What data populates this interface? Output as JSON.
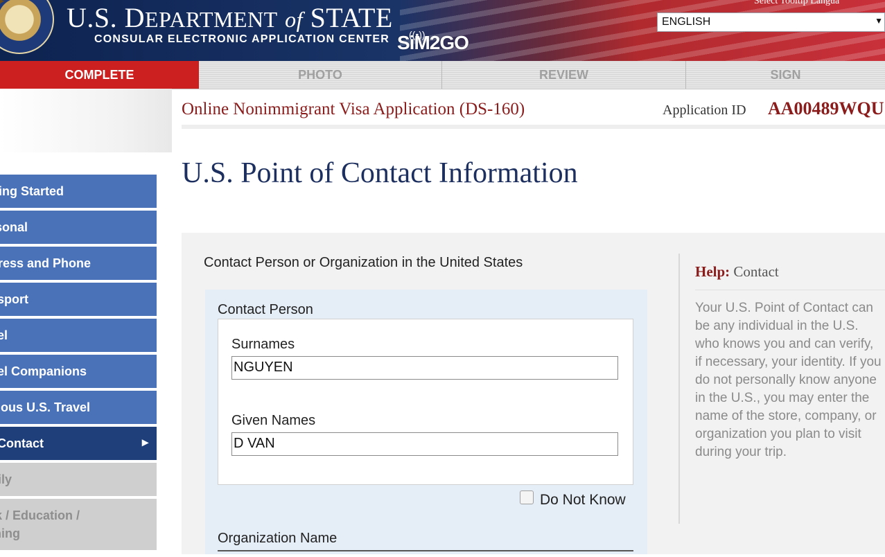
{
  "header": {
    "dept_title_pre": "U.S. D",
    "dept_title_rest": "EPARTMENT",
    "dept_title_of": "of",
    "dept_title_state": "STATE",
    "subtitle": "CONSULAR ELECTRONIC APPLICATION CENTER",
    "tooltip_language_label": "Select Tooltip Langua",
    "language_selected": "ENGLISH",
    "watermark": "SiM2GO"
  },
  "steps": [
    {
      "label": "COMPLETE",
      "active": true
    },
    {
      "label": "PHOTO",
      "active": false
    },
    {
      "label": "REVIEW",
      "active": false
    },
    {
      "label": "SIGN",
      "active": false
    }
  ],
  "subheader": {
    "form_title": "Online Nonimmigrant Visa Application (DS-160)",
    "application_id_label": "Application ID",
    "application_id_value": "AA00489WQU"
  },
  "sidenav": {
    "items": [
      {
        "label": "tting Started"
      },
      {
        "label": "rsonal"
      },
      {
        "label": "dress and Phone"
      },
      {
        "label": "ssport"
      },
      {
        "label": "vel"
      },
      {
        "label": "vel Companions"
      },
      {
        "label": "vious U.S. Travel"
      },
      {
        "label": ". Contact"
      },
      {
        "label": "nily"
      },
      {
        "label": "rk / Education / ining"
      }
    ]
  },
  "main": {
    "heading": "U.S. Point of Contact Information",
    "section_label": "Contact Person or Organization in the United States",
    "contact_person_label": "Contact Person",
    "surnames_label": "Surnames",
    "surnames_value": "NGUYEN",
    "given_names_label": "Given Names",
    "given_names_value": "D VAN",
    "do_not_know_label": "Do Not Know",
    "organization_name_label": "Organization Name"
  },
  "help": {
    "title_label": "Help:",
    "title_topic": "Contact",
    "body": "Your U.S. Point of Contact can be any individual in the U.S. who knows you and can verify, if necessary, your identity. If you do not personally know anyone in the U.S., you may enter the name of the store, company, or organization you plan to visit during your trip."
  },
  "colors": {
    "accent_red": "#cc1f1f",
    "nav_blue": "#4a72b8",
    "nav_current": "#1f3f7a",
    "heading_navy": "#1c2f5e"
  }
}
